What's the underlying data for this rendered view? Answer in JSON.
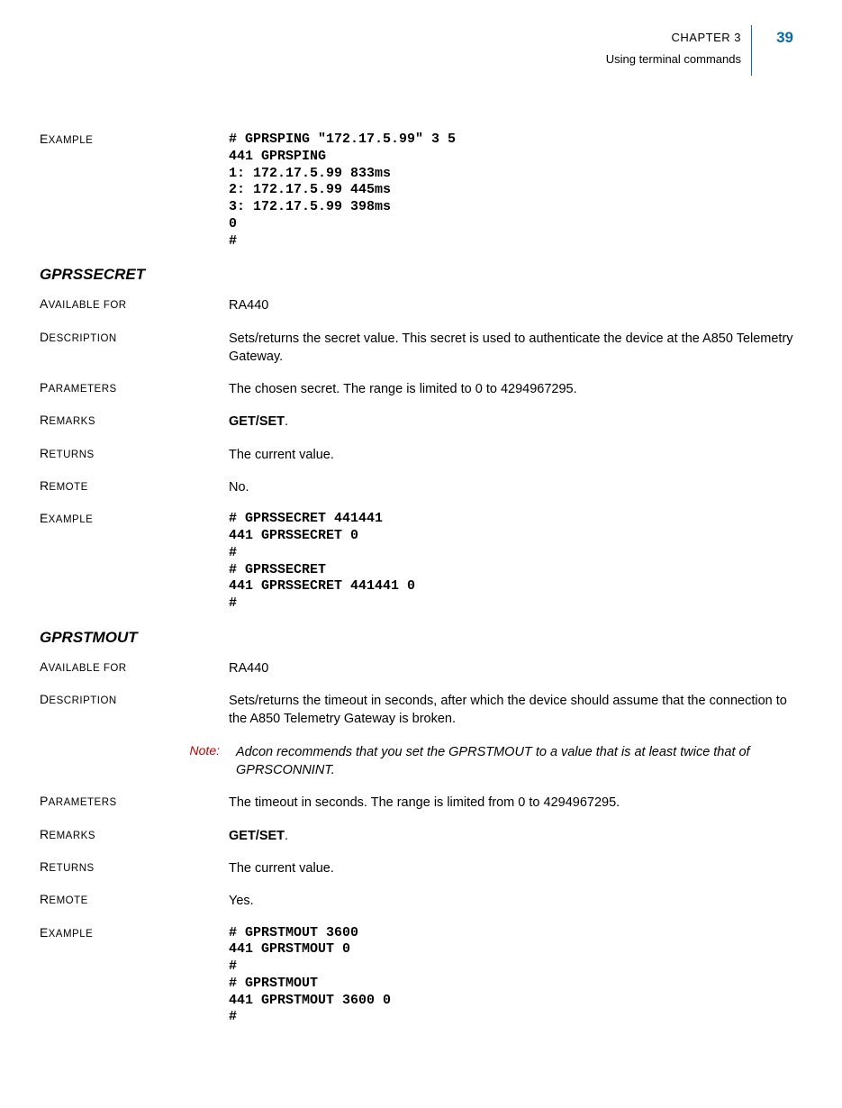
{
  "header": {
    "chapter": "CHAPTER 3",
    "subtitle": "Using terminal commands",
    "page_number": "39"
  },
  "blocks": [
    {
      "type": "row",
      "label": "Example",
      "style": "code",
      "value": "# GPRSPING \"172.17.5.99\" 3 5\n441 GPRSPING\n1: 172.17.5.99 833ms\n2: 172.17.5.99 445ms\n3: 172.17.5.99 398ms\n0\n#"
    },
    {
      "type": "section",
      "title": "GPRSSECRET"
    },
    {
      "type": "row",
      "label": "Available for",
      "value": "RA440"
    },
    {
      "type": "row",
      "label": "Description",
      "value": "Sets/returns the secret value. This secret is used to authenticate the device at the A850 Telemetry Gateway."
    },
    {
      "type": "row",
      "label": "Parameters",
      "value": "The chosen secret. The range is limited to 0 to 4294967295."
    },
    {
      "type": "row",
      "label": "Remarks",
      "value_parts": [
        {
          "text": "GET/SET",
          "bold": true
        },
        {
          "text": "."
        }
      ]
    },
    {
      "type": "row",
      "label": "Returns",
      "value": "The current value."
    },
    {
      "type": "row",
      "label": "Remote",
      "value": "No."
    },
    {
      "type": "row",
      "label": "Example",
      "style": "code",
      "value": "# GPRSSECRET 441441\n441 GPRSSECRET 0\n#\n# GPRSSECRET\n441 GPRSSECRET 441441 0\n#"
    },
    {
      "type": "section",
      "title": "GPRSTMOUT"
    },
    {
      "type": "row",
      "label": "Available for",
      "value": "RA440"
    },
    {
      "type": "row",
      "label": "Description",
      "value": "Sets/returns the timeout in seconds, after which the device should assume that the connection to the A850 Telemetry Gateway is broken."
    },
    {
      "type": "note",
      "label": "Note:",
      "value": "Adcon recommends that you set the GPRSTMOUT to a value that is at least twice that of GPRSCONNINT."
    },
    {
      "type": "row",
      "label": "Parameters",
      "value": "The timeout in seconds. The range is limited from 0 to 4294967295."
    },
    {
      "type": "row",
      "label": "Remarks",
      "value_parts": [
        {
          "text": "GET/SET",
          "bold": true
        },
        {
          "text": "."
        }
      ]
    },
    {
      "type": "row",
      "label": "Returns",
      "value": "The current value."
    },
    {
      "type": "row",
      "label": "Remote",
      "value": "Yes."
    },
    {
      "type": "row",
      "label": "Example",
      "style": "code",
      "value": "# GPRSTMOUT 3600\n441 GPRSTMOUT 0\n#\n# GPRSTMOUT\n441 GPRSTMOUT 3600 0\n#"
    }
  ]
}
